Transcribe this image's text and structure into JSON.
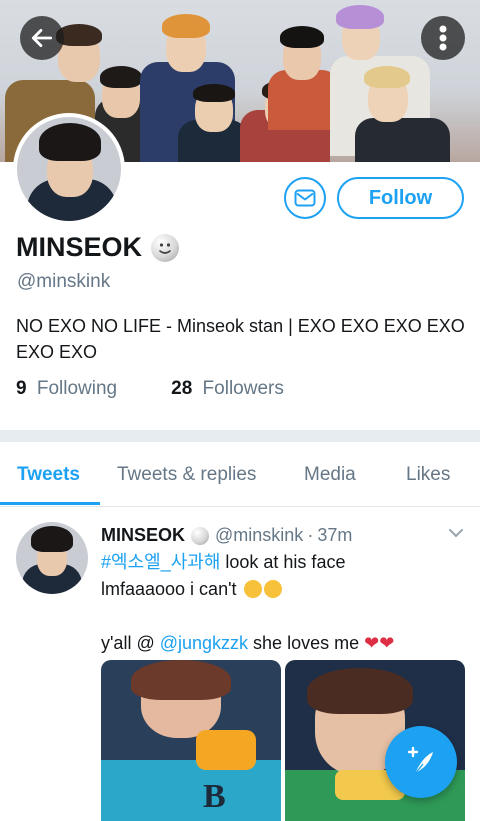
{
  "profile": {
    "name": "MINSEOK",
    "handle": "@minskink",
    "bio": "NO EXO NO LIFE - Minseok stan | EXO EXO EXO EXO EXO EXO",
    "following_count": "9",
    "following_label": "Following",
    "followers_count": "28",
    "followers_label": "Followers",
    "follow_button": "Follow"
  },
  "icons": {
    "back": "arrow-left-icon",
    "more": "more-vertical-icon",
    "message": "envelope-icon",
    "verified_style": "smiley-emoji-icon",
    "compose": "feather-compose-icon"
  },
  "tabs": [
    {
      "label": "Tweets",
      "active": true
    },
    {
      "label": "Tweets & replies",
      "active": false
    },
    {
      "label": "Media",
      "active": false
    },
    {
      "label": "Likes",
      "active": false
    }
  ],
  "tweet": {
    "name": "MINSEOK",
    "handle": "@minskink",
    "time": "37m",
    "hashtag": "#엑소엘_사과해",
    "text1": " look at his face",
    "text2": "lmfaaaooo i can't",
    "text3_prefix": "y'all @ ",
    "mention": "@jungkzzk",
    "text3_suffix": " she loves me"
  },
  "colors": {
    "accent": "#1da1f2",
    "text_primary": "#14171a",
    "text_secondary": "#657786",
    "separator": "#e6ecf0",
    "heart": "#dd2e44"
  }
}
